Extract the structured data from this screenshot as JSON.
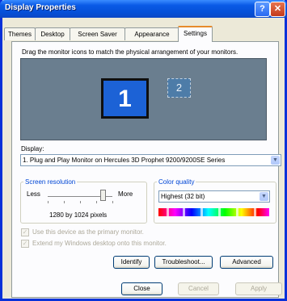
{
  "window": {
    "title": "Display Properties",
    "help_glyph": "?",
    "close_glyph": "✕"
  },
  "tabs": [
    "Themes",
    "Desktop",
    "Screen Saver",
    "Appearance",
    "Settings"
  ],
  "active_tab": "Settings",
  "settings": {
    "instruction": "Drag the monitor icons to match the physical arrangement of your monitors.",
    "monitor_primary": "1",
    "monitor_secondary": "2",
    "display_label": "Display:",
    "display_value": "1. Plug and Play Monitor on Hercules 3D Prophet 9200/9200SE Series",
    "resolution": {
      "group_title": "Screen resolution",
      "less": "Less",
      "more": "More",
      "value_text": "1280 by 1024 pixels",
      "slider_level": 0.85
    },
    "color_quality": {
      "group_title": "Color quality",
      "value": "Highest (32 bit)"
    },
    "checkbox_primary": {
      "label": "Use this device as the primary monitor.",
      "checked": true,
      "enabled": false
    },
    "checkbox_extend": {
      "label": "Extend my Windows desktop onto this monitor.",
      "checked": true,
      "enabled": false
    },
    "buttons": {
      "identify": "Identify",
      "troubleshoot": "Troubleshoot...",
      "advanced": "Advanced"
    }
  },
  "footer": {
    "close": "Close",
    "cancel": "Cancel",
    "apply": "Apply"
  },
  "colors": {
    "accent": "#0a5ae6",
    "tab_highlight": "#e68b2c",
    "group_title": "#0046d5"
  },
  "icons": [
    "help-icon",
    "close-icon",
    "chevron-down-icon",
    "checkmark-icon"
  ]
}
